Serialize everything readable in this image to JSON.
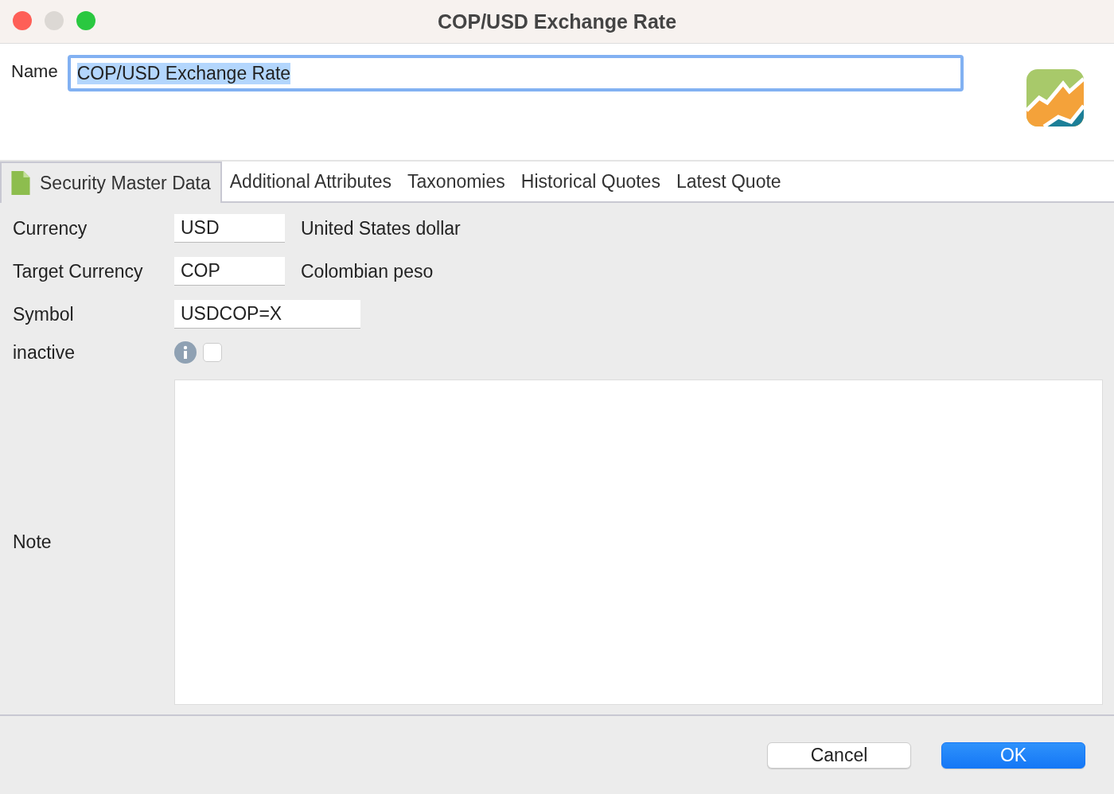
{
  "window": {
    "title": "COP/USD Exchange Rate"
  },
  "name": {
    "label": "Name",
    "value": "COP/USD Exchange Rate",
    "text_selected": true
  },
  "tabs": [
    {
      "label": "Security Master Data",
      "selected": true
    },
    {
      "label": "Additional Attributes",
      "selected": false
    },
    {
      "label": "Taxonomies",
      "selected": false
    },
    {
      "label": "Historical Quotes",
      "selected": false
    },
    {
      "label": "Latest Quote",
      "selected": false
    }
  ],
  "form": [
    {
      "kind": "currency",
      "label": "Currency",
      "value": "USD",
      "description": "United States dollar"
    },
    {
      "kind": "currency",
      "label": "Target Currency",
      "value": "COP",
      "description": "Colombian peso"
    },
    {
      "kind": "field",
      "label": "Symbol",
      "value": "USDCOP=X"
    },
    {
      "kind": "checkbox",
      "label": "inactive",
      "checked": false
    },
    {
      "kind": "note",
      "label": "Note"
    }
  ],
  "buttons": [
    {
      "label": "Cancel",
      "kind": "default"
    },
    {
      "label": "OK",
      "kind": "primary"
    }
  ]
}
